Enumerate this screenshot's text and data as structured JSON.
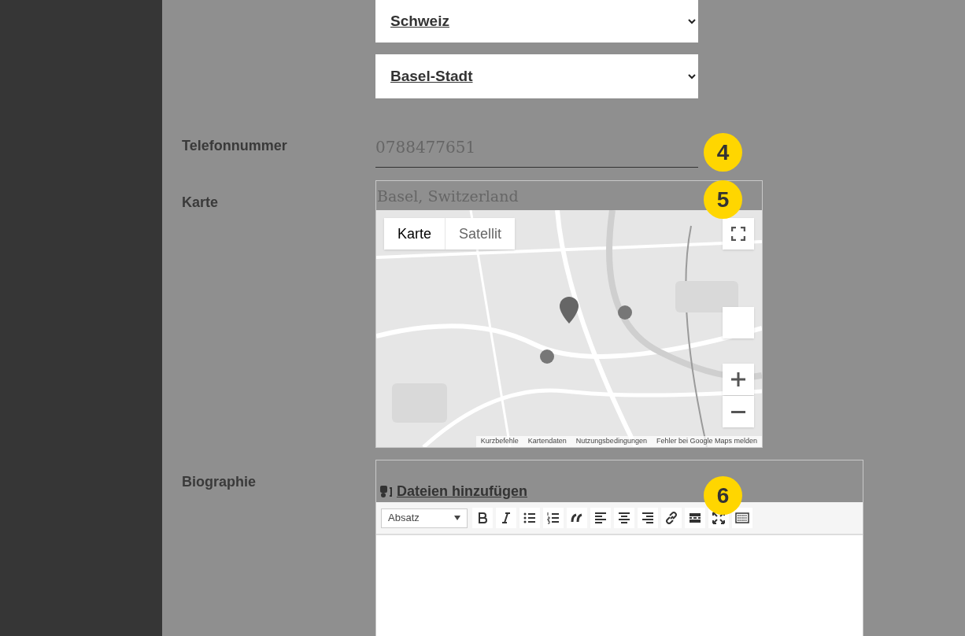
{
  "location_selects": [
    {
      "value": "Schweiz"
    },
    {
      "value": "Basel-Stadt"
    }
  ],
  "phone": {
    "label": "Telefonnummer",
    "value": "0788477651"
  },
  "map": {
    "label": "Karte",
    "search_value": "Basel, Switzerland",
    "map_types": [
      {
        "label": "Karte",
        "selected": true
      },
      {
        "label": "Satellit",
        "selected": false
      }
    ],
    "footer_links": [
      "Kurzbefehle",
      "Kartendaten",
      "Nutzungsbedingungen",
      "Fehler bei Google Maps melden"
    ]
  },
  "biography": {
    "label": "Biographie",
    "add_files": "Dateien hinzufügen",
    "format": "Absatz",
    "toolbar": [
      {
        "kind": "bold"
      },
      {
        "kind": "italic"
      },
      {
        "kind": "bullets"
      },
      {
        "kind": "numbers"
      },
      {
        "kind": "quote"
      },
      {
        "kind": "align-left"
      },
      {
        "kind": "align-center"
      },
      {
        "kind": "align-right"
      },
      {
        "kind": "link"
      },
      {
        "kind": "more"
      },
      {
        "kind": "fullscreen"
      },
      {
        "kind": "keyboard"
      }
    ]
  },
  "step_badges": [
    "4",
    "5",
    "6"
  ]
}
